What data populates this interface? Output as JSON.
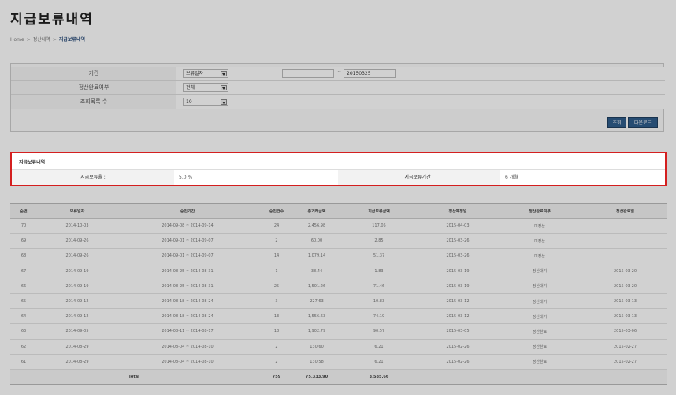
{
  "page_title": "지급보류내역",
  "breadcrumb": [
    "Home",
    "정산내역",
    "지급보류내역"
  ],
  "search": {
    "period_label": "기간",
    "period_type": "보류일자",
    "date_from": "",
    "date_separator": "~",
    "date_to": "20150325",
    "settle_done_label": "정산완료여부",
    "settle_done_value": "전체",
    "rows_label": "조회목록 수",
    "rows_value": "10",
    "search_button": "조회",
    "download_button": "다운로드"
  },
  "hold_info": {
    "title": "지급보류내역",
    "rate_label": "지급보류율 :",
    "rate_value": "5.0 %",
    "period_label": "지급보류기간 :",
    "period_value": "6 개월"
  },
  "table": {
    "headers": [
      "순번",
      "보류일자",
      "승인기간",
      "승인건수",
      "총거래금액",
      "지급보류금액",
      "정산예정일",
      "정산완료여부",
      "정산완료일"
    ],
    "rows": [
      [
        "70",
        "2014-10-03",
        "2014-09-08 ~ 2014-09-14",
        "24",
        "2,456.98",
        "117.05",
        "2015-04-03",
        "미정산",
        ""
      ],
      [
        "69",
        "2014-09-26",
        "2014-09-01 ~ 2014-09-07",
        "2",
        "60.00",
        "2.85",
        "2015-03-26",
        "미정산",
        ""
      ],
      [
        "68",
        "2014-09-26",
        "2014-09-01 ~ 2014-09-07",
        "14",
        "1,079.14",
        "51.37",
        "2015-03-26",
        "미정산",
        ""
      ],
      [
        "67",
        "2014-09-19",
        "2014-08-25 ~ 2014-08-31",
        "1",
        "38.44",
        "1.83",
        "2015-03-19",
        "정산대기",
        "2015-03-20"
      ],
      [
        "66",
        "2014-09-19",
        "2014-08-25 ~ 2014-08-31",
        "25",
        "1,501.26",
        "71.46",
        "2015-03-19",
        "정산대기",
        "2015-03-20"
      ],
      [
        "65",
        "2014-09-12",
        "2014-08-18 ~ 2014-08-24",
        "3",
        "227.63",
        "10.83",
        "2015-03-12",
        "정산대기",
        "2015-03-13"
      ],
      [
        "64",
        "2014-09-12",
        "2014-08-18 ~ 2014-08-24",
        "13",
        "1,556.63",
        "74.19",
        "2015-03-12",
        "정산대기",
        "2015-03-13"
      ],
      [
        "63",
        "2014-09-05",
        "2014-08-11 ~ 2014-08-17",
        "18",
        "1,902.79",
        "90.57",
        "2015-03-05",
        "정산완료",
        "2015-03-06"
      ],
      [
        "62",
        "2014-08-29",
        "2014-08-04 ~ 2014-08-10",
        "2",
        "130.60",
        "6.21",
        "2015-02-26",
        "정산완료",
        "2015-02-27"
      ],
      [
        "61",
        "2014-08-29",
        "2014-08-04 ~ 2014-08-10",
        "2",
        "130.58",
        "6.21",
        "2015-02-26",
        "정산완료",
        "2015-02-27"
      ]
    ],
    "total": {
      "label": "Total",
      "count": "759",
      "amount": "75,333.90",
      "hold_amount": "3,585.66"
    }
  }
}
